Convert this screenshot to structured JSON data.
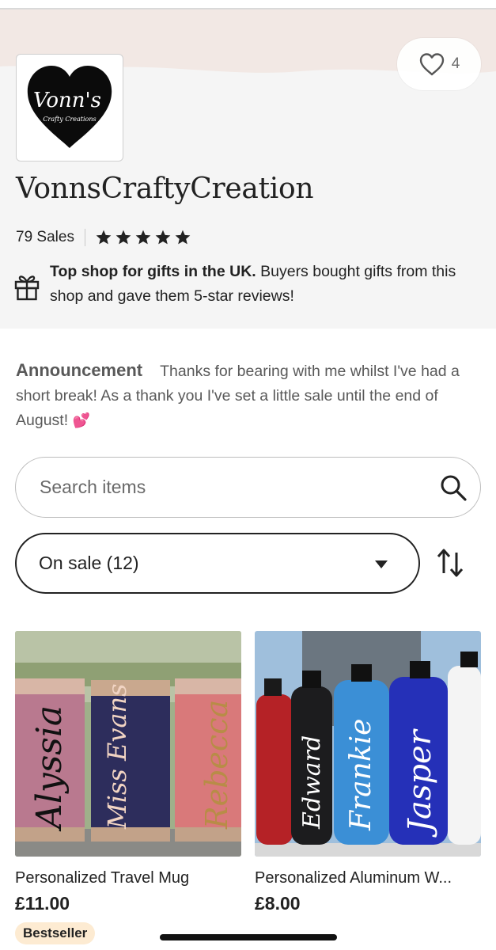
{
  "shop": {
    "logo_text": "Vonn's",
    "logo_subtext": "Crafty Creations",
    "name": "VonnsCraftyCreation",
    "sales": "79 Sales",
    "rating_stars": 5,
    "favorites_count": "4",
    "gift_bold": "Top shop for gifts in the UK.",
    "gift_text": " Buyers bought gifts from this shop and gave them 5-star reviews!"
  },
  "announcement": {
    "title": "Announcement",
    "text": "Thanks for bearing with me whilst I've had a short break! As a thank you I've set a little sale until the end of August!",
    "emoji": "💕"
  },
  "search": {
    "placeholder": "Search items"
  },
  "filter": {
    "selected": "On sale (12)"
  },
  "products": [
    {
      "title": "Personalized Travel Mug",
      "price": "£11.00",
      "badge": "Bestseller",
      "image_names": [
        "Alyssia",
        "Miss Evans",
        "Rebecca"
      ]
    },
    {
      "title": "Personalized Aluminum W...",
      "price": "£8.00",
      "image_names": [
        "Edward",
        "Frankie",
        "Jasper"
      ]
    }
  ],
  "colors": {
    "banner": "#f2e8e4",
    "header_bg": "#f5f5f5",
    "badge_bg": "#fdebd2",
    "text": "#222222",
    "muted": "#595959"
  }
}
